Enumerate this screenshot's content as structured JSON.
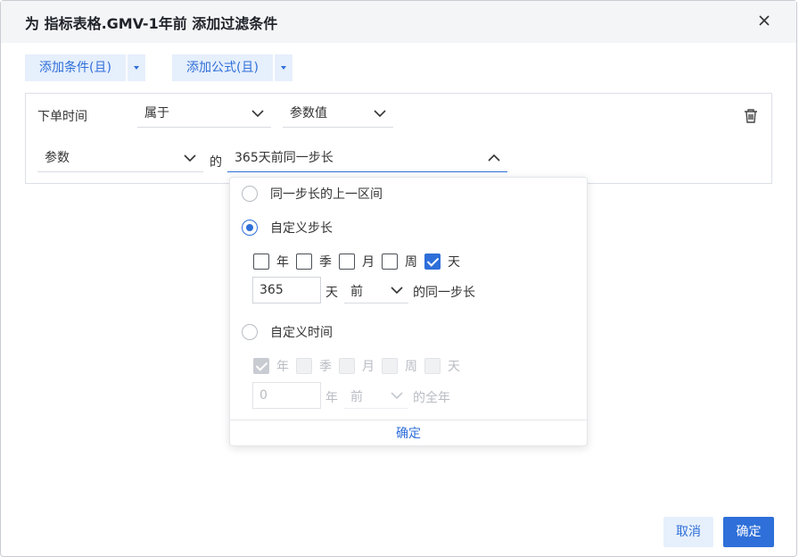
{
  "dialog": {
    "title": "为 指标表格.GMV-1年前 添加过滤条件",
    "close_icon": "close-icon"
  },
  "toolbar": {
    "add_condition_label": "添加条件(且)",
    "add_formula_label": "添加公式(且)"
  },
  "condition": {
    "field_label": "下单时间",
    "operator": "属于",
    "value_type": "参数值",
    "param_select": "参数",
    "of_text": "的",
    "param_value": "365天前同一步长"
  },
  "popup": {
    "option_prev_interval": "同一步长的上一区间",
    "option_custom_step": "自定义步长",
    "step_units": [
      {
        "label": "年",
        "checked": false
      },
      {
        "label": "季",
        "checked": false
      },
      {
        "label": "月",
        "checked": false
      },
      {
        "label": "周",
        "checked": false
      },
      {
        "label": "天",
        "checked": true
      }
    ],
    "step_value": "365",
    "step_unit_text": "天",
    "step_direction": "前",
    "step_suffix": "的同一步长",
    "option_custom_time": "自定义时间",
    "time_units": [
      {
        "label": "年",
        "checked": true
      },
      {
        "label": "季",
        "checked": false
      },
      {
        "label": "月",
        "checked": false
      },
      {
        "label": "周",
        "checked": false
      },
      {
        "label": "天",
        "checked": false
      }
    ],
    "time_value": "0",
    "time_unit_text": "年",
    "time_direction": "前",
    "time_suffix": "的全年",
    "confirm_label": "确定"
  },
  "footer": {
    "cancel_label": "取消",
    "ok_label": "确定"
  },
  "colors": {
    "accent": "#2e6fd9",
    "accent_light": "#e6effc"
  }
}
